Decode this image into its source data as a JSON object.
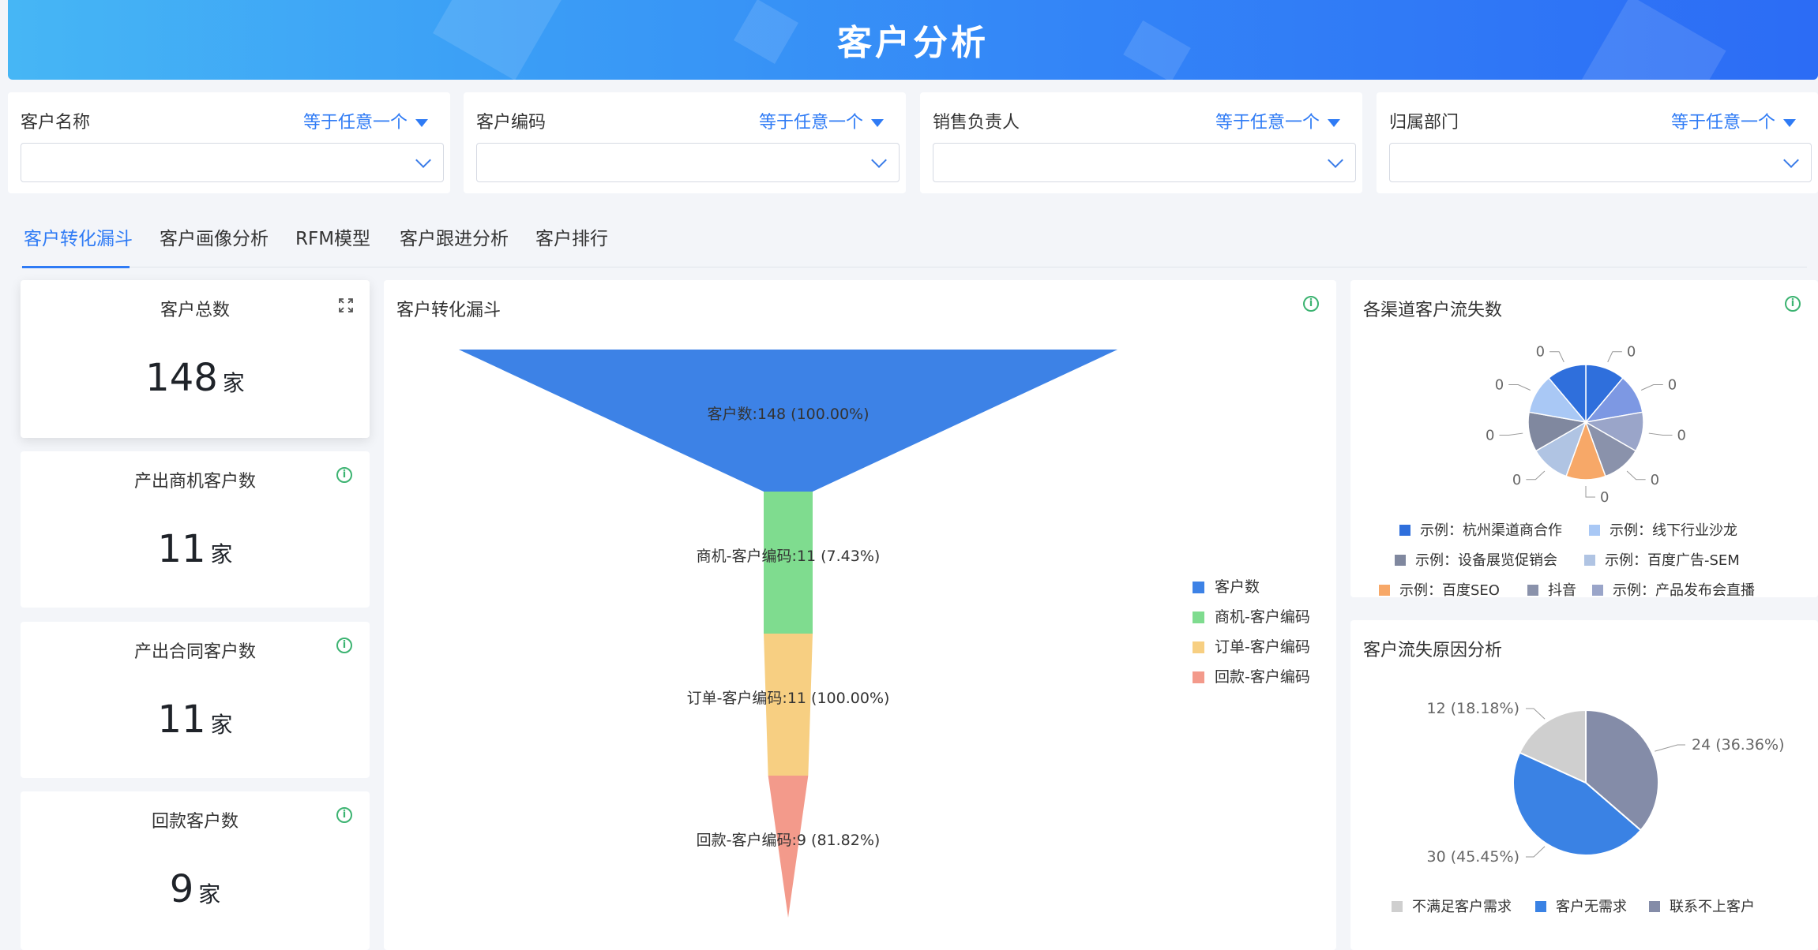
{
  "header": {
    "title": "客户分析"
  },
  "filters": [
    {
      "label": "客户名称",
      "operator": "等于任意一个"
    },
    {
      "label": "客户编码",
      "operator": "等于任意一个"
    },
    {
      "label": "销售负责人",
      "operator": "等于任意一个"
    },
    {
      "label": "归属部门",
      "operator": "等于任意一个"
    }
  ],
  "tabs": [
    "客户转化漏斗",
    "客户画像分析",
    "RFM模型",
    "客户跟进分析",
    "客户排行"
  ],
  "active_tab": "客户转化漏斗",
  "kpis": [
    {
      "title": "客户总数",
      "value": "148",
      "unit": "家"
    },
    {
      "title": "产出商机客户数",
      "value": "11",
      "unit": "家"
    },
    {
      "title": "产出合同客户数",
      "value": "11",
      "unit": "家"
    },
    {
      "title": "回款客户数",
      "value": "9",
      "unit": "家"
    }
  ],
  "funnel_panel": {
    "title": "客户转化漏斗"
  },
  "channel_panel": {
    "title": "各渠道客户流失数"
  },
  "reason_panel": {
    "title": "客户流失原因分析"
  },
  "colors": {
    "brand_blue": "#2f7bf5",
    "funnel": [
      "#3d82e6",
      "#7fdc8f",
      "#f7cf82",
      "#f39a8b"
    ],
    "info_green": "#3cb371"
  },
  "chart_data": [
    {
      "type": "funnel",
      "title": "客户转化漏斗",
      "categories": [
        "客户数",
        "商机-客户编码",
        "订单-客户编码",
        "回款-客户编码"
      ],
      "values": [
        148,
        11,
        11,
        9
      ],
      "labels": [
        "客户数:148 (100.00%)",
        "商机-客户编码:11 (7.43%)",
        "订单-客户编码:11 (100.00%)",
        "回款-客户编码:9 (81.82%)"
      ],
      "legend": [
        "客户数",
        "商机-客户编码",
        "订单-客户编码",
        "回款-客户编码"
      ],
      "legend_position": "right"
    },
    {
      "type": "pie",
      "title": "各渠道客户流失数",
      "categories": [
        "示例：杭州渠道商合作",
        "示例：线下行业沙龙",
        "示例：设备展览促销会",
        "示例：百度广告-SEM",
        "示例：百度SEO",
        "抖音",
        "示例：产品发布会直播",
        "",
        ""
      ],
      "values": [
        0,
        0,
        0,
        0,
        0,
        0,
        0,
        0,
        0
      ],
      "slice_labels": [
        "0",
        "0",
        "0",
        "0",
        "0",
        "0",
        "0",
        "0",
        "0"
      ],
      "colors": [
        "#2f6fdc",
        "#7d98e3",
        "#9aa5c9",
        "#8a92ab",
        "#f7a868",
        "#b0c4e3",
        "#80889f",
        "#a9c8f5",
        "#2f6fdc"
      ],
      "legend": [
        "示例：杭州渠道商合作",
        "示例：线下行业沙龙",
        "示例：设备展览促销会",
        "示例：百度广告-SEM",
        "示例：百度SEO",
        "抖音",
        "示例：产品发布会直播"
      ],
      "legend_colors": [
        "#2f6fdc",
        "#a9c8f5",
        "#80889f",
        "#b0c4e3",
        "#f7a868",
        "#8a92ab",
        "#9aa5c9"
      ],
      "legend_position": "bottom"
    },
    {
      "type": "pie",
      "title": "客户流失原因分析",
      "categories": [
        "联系不上客户",
        "客户无需求",
        "不满足客户需求"
      ],
      "values": [
        24,
        30,
        12
      ],
      "labels": [
        "24 (36.36%)",
        "30 (45.45%)",
        "12 (18.18%)"
      ],
      "colors": [
        "#848ca8",
        "#3a82e4",
        "#cfcfcf"
      ],
      "legend": [
        "不满足客户需求",
        "客户无需求",
        "联系不上客户"
      ],
      "legend_colors": [
        "#cfcfcf",
        "#3a82e4",
        "#848ca8"
      ],
      "legend_position": "bottom"
    }
  ]
}
